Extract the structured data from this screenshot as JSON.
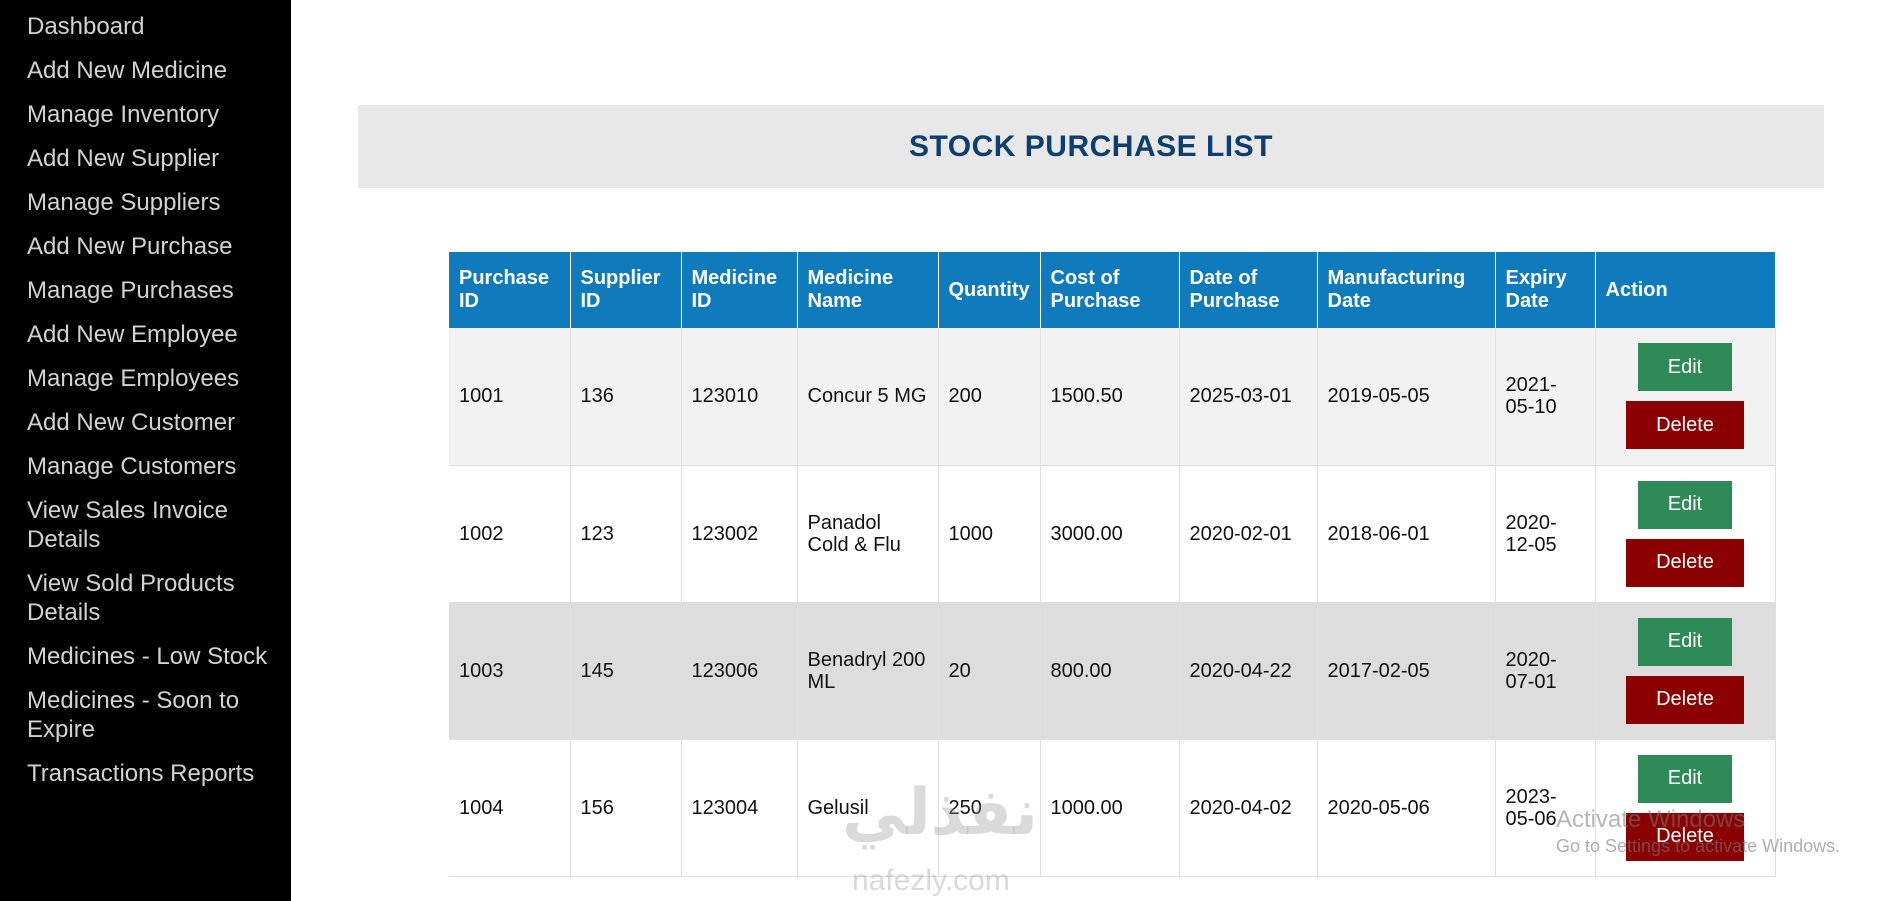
{
  "sidebar": {
    "items": [
      {
        "label": "Dashboard"
      },
      {
        "label": "Add New Medicine"
      },
      {
        "label": "Manage Inventory"
      },
      {
        "label": "Add New Supplier"
      },
      {
        "label": "Manage Suppliers"
      },
      {
        "label": "Add New Purchase"
      },
      {
        "label": "Manage Purchases"
      },
      {
        "label": "Add New Employee"
      },
      {
        "label": "Manage Employees"
      },
      {
        "label": "Add New Customer"
      },
      {
        "label": "Manage Customers"
      },
      {
        "label": "View Sales Invoice Details"
      },
      {
        "label": "View Sold Products Details"
      },
      {
        "label": "Medicines - Low Stock"
      },
      {
        "label": "Medicines - Soon to Expire"
      },
      {
        "label": "Transactions Reports"
      }
    ]
  },
  "page": {
    "title": "STOCK PURCHASE LIST"
  },
  "table": {
    "headers": [
      "Purchase ID",
      "Supplier ID",
      "Medicine ID",
      "Medicine Name",
      "Quantity",
      "Cost of Purchase",
      "Date of Purchase",
      "Manufacturing Date",
      "Expiry Date",
      "Action"
    ],
    "edit_label": "Edit",
    "delete_label": "Delete",
    "rows": [
      {
        "purchase_id": "1001",
        "supplier_id": "136",
        "medicine_id": "123010",
        "medicine_name": "Concur 5 MG",
        "quantity": "200",
        "cost": "1500.50",
        "purchase_date": "2025-03-01",
        "mfg_date": "2019-05-05",
        "expiry_date": "2021-05-10"
      },
      {
        "purchase_id": "1002",
        "supplier_id": "123",
        "medicine_id": "123002",
        "medicine_name": "Panadol Cold & Flu",
        "quantity": "1000",
        "cost": "3000.00",
        "purchase_date": "2020-02-01",
        "mfg_date": "2018-06-01",
        "expiry_date": "2020-12-05"
      },
      {
        "purchase_id": "1003",
        "supplier_id": "145",
        "medicine_id": "123006",
        "medicine_name": "Benadryl 200 ML",
        "quantity": "20",
        "cost": "800.00",
        "purchase_date": "2020-04-22",
        "mfg_date": "2017-02-05",
        "expiry_date": "2020-07-01"
      },
      {
        "purchase_id": "1004",
        "supplier_id": "156",
        "medicine_id": "123004",
        "medicine_name": "Gelusil",
        "quantity": "250",
        "cost": "1000.00",
        "purchase_date": "2020-04-02",
        "mfg_date": "2020-05-06",
        "expiry_date": "2023-05-06"
      }
    ]
  },
  "overlays": {
    "watermark": "نفذلي",
    "watermark_sub": "nafezly.com",
    "activation_title": "Activate Windows",
    "activation_sub": "Go to Settings to activate Windows."
  }
}
